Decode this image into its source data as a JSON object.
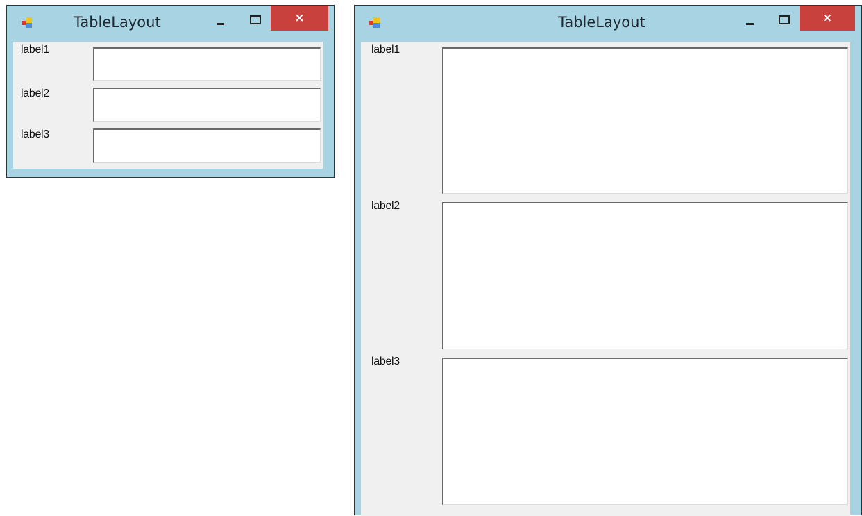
{
  "windows": [
    {
      "title": "TableLayout",
      "close_glyph": "×",
      "labels": [
        "label1",
        "label2",
        "label3"
      ],
      "textboxes": [
        "",
        "",
        ""
      ]
    },
    {
      "title": "TableLayout",
      "close_glyph": "×",
      "labels": [
        "label1",
        "label2",
        "label3"
      ],
      "textboxes": [
        "",
        "",
        ""
      ]
    }
  ],
  "icons": {
    "app": "application-icon",
    "minimize": "minimize-icon",
    "maximize": "maximize-icon",
    "close": "close-icon"
  },
  "colors": {
    "frame": "#a8d3e2",
    "close_button": "#c9413c",
    "client_background": "#f0f0f0"
  }
}
